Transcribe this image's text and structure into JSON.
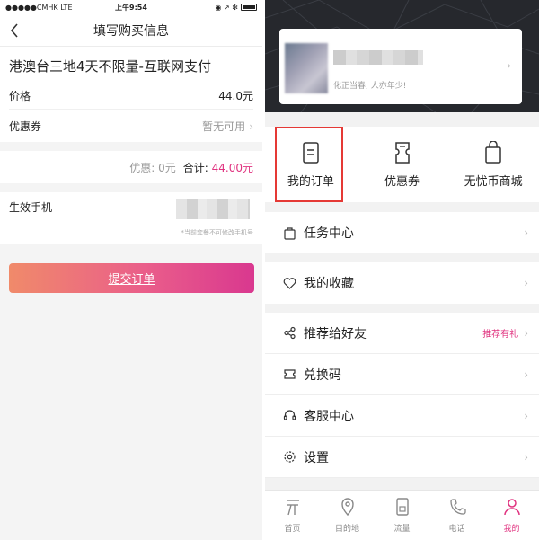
{
  "left": {
    "status": {
      "carrier": "●●●●●CMHK  LTE",
      "time": "上午9:54",
      "icons": "◉ ↗ ✻"
    },
    "nav": {
      "title": "填写购买信息"
    },
    "product": {
      "name": "港澳台三地4天不限量-互联网支付",
      "price_label": "价格",
      "price_value": "44.0元",
      "coupon_label": "优惠券",
      "coupon_value": "暂无可用"
    },
    "summary": {
      "discount": "优惠: 0元",
      "total_label": "合计:",
      "total_value": "44.00元"
    },
    "phone": {
      "label": "生效手机",
      "hint": "*当前套餐不可修改手机号"
    },
    "submit_label": "提交订单"
  },
  "right": {
    "profile": {
      "slogan": "化正当春, 人亦年少!"
    },
    "quick": [
      {
        "label": "我的订单",
        "icon": "order-icon"
      },
      {
        "label": "优惠券",
        "icon": "coupon-icon"
      },
      {
        "label": "无忧币商城",
        "icon": "shopping-bag-icon"
      }
    ],
    "menu": [
      {
        "label": "任务中心",
        "icon": "task-icon"
      },
      {
        "label": "我的收藏",
        "icon": "heart-icon"
      },
      {
        "label": "推荐给好友",
        "icon": "share-icon",
        "extra": "推荐有礼"
      },
      {
        "label": "兑换码",
        "icon": "ticket-icon"
      },
      {
        "label": "客服中心",
        "icon": "headset-icon"
      },
      {
        "label": "设置",
        "icon": "gear-icon"
      }
    ],
    "tabs": [
      {
        "label": "首页",
        "icon": "home-icon"
      },
      {
        "label": "目的地",
        "icon": "location-icon"
      },
      {
        "label": "流量",
        "icon": "data-card-icon"
      },
      {
        "label": "电话",
        "icon": "phone-icon"
      },
      {
        "label": "我的",
        "icon": "person-icon",
        "active": true
      }
    ],
    "accent": "#e0327f",
    "highlight_color": "#e53935"
  }
}
